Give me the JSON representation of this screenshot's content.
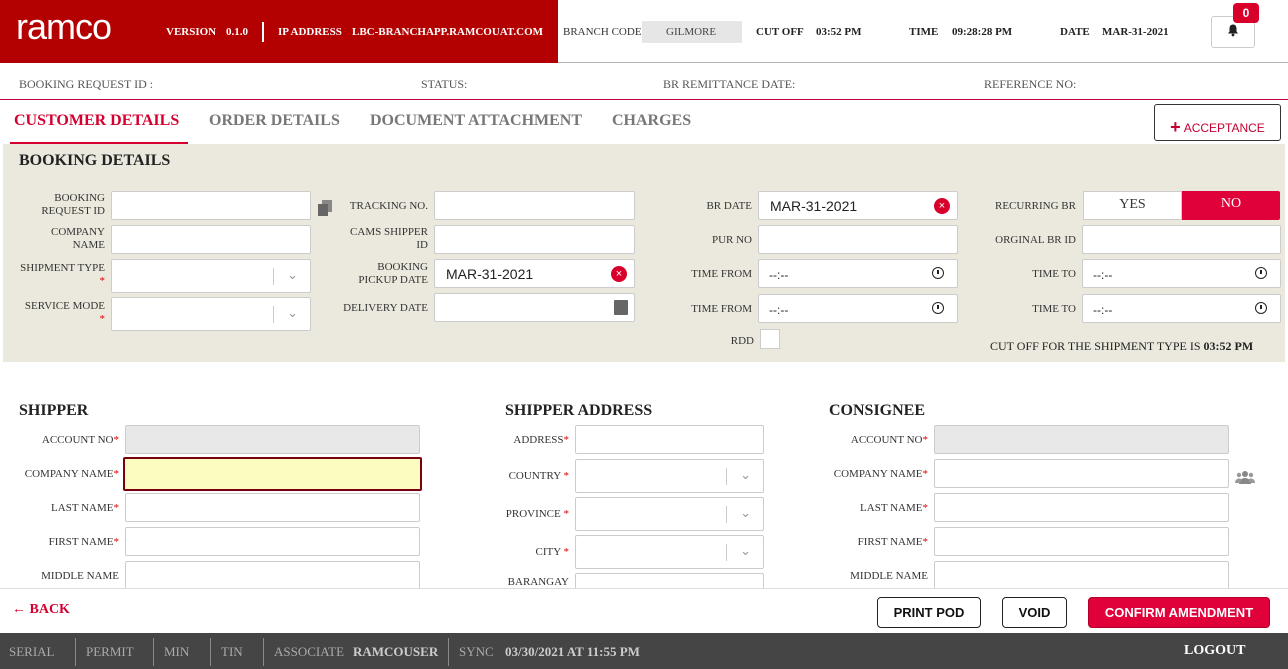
{
  "header": {
    "logo": "ramco",
    "version_label": "VERSION",
    "version": "0.1.0",
    "ip_label": "IP ADDRESS",
    "ip": "LBC-BRANCHAPP.RAMCOUAT.COM",
    "branch_label": "BRANCH CODE",
    "branch": "GILMORE",
    "cutoff_label": "CUT OFF",
    "cutoff": "03:52 PM",
    "time_label": "TIME",
    "time": "09:28:28 PM",
    "date_label": "DATE",
    "date": "MAR-31-2021",
    "notifications": "0"
  },
  "info": {
    "booking_request_id": "BOOKING REQUEST ID :",
    "status": "STATUS:",
    "br_remittance_date": "BR REMITTANCE DATE:",
    "reference_no": "REFERENCE NO:"
  },
  "tabs": [
    "CUSTOMER DETAILS",
    "ORDER DETAILS",
    "DOCUMENT ATTACHMENT",
    "CHARGES"
  ],
  "acceptance": "ACCEPTANCE",
  "booking": {
    "title": "BOOKING DETAILS",
    "booking_request_id_l1": "BOOKING",
    "booking_request_id_l2": "REQUEST ID",
    "company_l1": "COMPANY",
    "company_l2": "NAME",
    "shipment_type": "SHIPMENT TYPE",
    "service_mode": "SERVICE MODE",
    "tracking_no": "TRACKING NO.",
    "cams_l1": "CAMS SHIPPER",
    "cams_l2": "ID",
    "pickup_l1": "BOOKING",
    "pickup_l2": "PICKUP DATE",
    "pickup_date": "MAR-31-2021",
    "delivery_date": "DELIVERY DATE",
    "br_date_label": "BR DATE",
    "br_date": "MAR-31-2021",
    "pur_no": "PUR NO",
    "time_from": "TIME FROM",
    "time_to": "TIME TO",
    "time_placeholder": "--:--",
    "rdd": "RDD",
    "recurring_br": "RECURRING BR",
    "yes": "YES",
    "no": "NO",
    "original_br_id": "ORGINAL BR ID",
    "cutoff_text": "CUT OFF FOR THE SHIPMENT TYPE IS",
    "cutoff_time": "03:52 PM"
  },
  "shipper": {
    "title": "SHIPPER",
    "account_no": "ACCOUNT NO",
    "company_name": "COMPANY NAME",
    "last_name": "LAST NAME",
    "first_name": "FIRST NAME",
    "middle_name": "MIDDLE NAME"
  },
  "shipper_address": {
    "title": "SHIPPER ADDRESS",
    "address": "ADDRESS",
    "country": "COUNTRY",
    "province": "PROVINCE",
    "city": "CITY",
    "barangay": "BARANGAY"
  },
  "consignee": {
    "title": "CONSIGNEE",
    "account_no": "ACCOUNT NO",
    "company_name": "COMPANY NAME",
    "last_name": "LAST NAME",
    "first_name": "FIRST NAME",
    "middle_name": "MIDDLE NAME"
  },
  "actions": {
    "back": "BACK",
    "print_pod": "PRINT POD",
    "void": "VOID",
    "confirm": "CONFIRM AMENDMENT"
  },
  "status": {
    "serial": "SERIAL",
    "permit": "PERMIT",
    "min": "MIN",
    "tin": "TIN",
    "associate_label": "ASSOCIATE",
    "associate": "RAMCOUSER",
    "sync_label": "SYNC",
    "sync": "03/30/2021 AT 11:55 PM",
    "logout": "LOGOUT"
  },
  "colors": {
    "brand_red": "#b30000",
    "accent": "#e0003a",
    "panel": "#ebe8dd",
    "status_bar": "#454545"
  }
}
